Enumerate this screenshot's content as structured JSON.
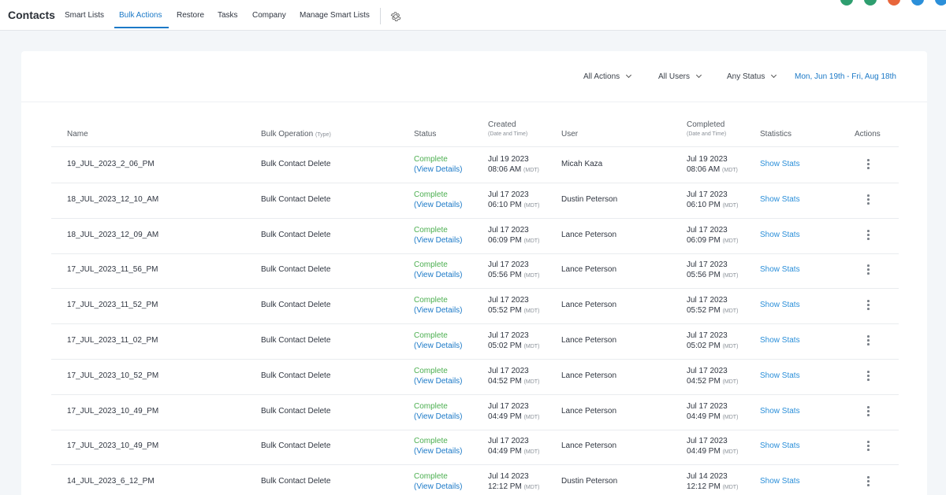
{
  "header": {
    "title": "Contacts",
    "tabs": [
      "Smart Lists",
      "Bulk Actions",
      "Restore",
      "Tasks",
      "Company",
      "Manage Smart Lists"
    ],
    "active_tab": "Bulk Actions",
    "avatar_colors": [
      "#2e9e6f",
      "#2e9e6f",
      "#e8663b",
      "#2b8fd9",
      "#2b8fd9"
    ]
  },
  "filters": {
    "actions": "All Actions",
    "users": "All Users",
    "status": "Any Status",
    "date_range": "Mon, Jun 19th - Fri, Aug 18th"
  },
  "table": {
    "columns": {
      "name": "Name",
      "operation": "Bulk Operation",
      "operation_sub": "(Type)",
      "status": "Status",
      "created": "Created",
      "created_sub": "(Date and Time)",
      "user": "User",
      "completed": "Completed",
      "completed_sub": "(Date and Time)",
      "statistics": "Statistics",
      "actions": "Actions"
    },
    "rows": [
      {
        "name": "19_JUL_2023_2_06_PM",
        "operation": "Bulk Contact Delete",
        "status": "Complete",
        "details": "(View Details)",
        "created_date": "Jul 19 2023",
        "created_time": "08:06 AM",
        "tz": "(MDT)",
        "user": "Micah Kaza",
        "completed_date": "Jul 19 2023",
        "completed_time": "08:06 AM",
        "stats": "Show Stats"
      },
      {
        "name": "18_JUL_2023_12_10_AM",
        "operation": "Bulk Contact Delete",
        "status": "Complete",
        "details": "(View Details)",
        "created_date": "Jul 17 2023",
        "created_time": "06:10 PM",
        "tz": "(MDT)",
        "user": "Dustin Peterson",
        "completed_date": "Jul 17 2023",
        "completed_time": "06:10 PM",
        "stats": "Show Stats"
      },
      {
        "name": "18_JUL_2023_12_09_AM",
        "operation": "Bulk Contact Delete",
        "status": "Complete",
        "details": "(View Details)",
        "created_date": "Jul 17 2023",
        "created_time": "06:09 PM",
        "tz": "(MDT)",
        "user": "Lance Peterson",
        "completed_date": "Jul 17 2023",
        "completed_time": "06:09 PM",
        "stats": "Show Stats"
      },
      {
        "name": "17_JUL_2023_11_56_PM",
        "operation": "Bulk Contact Delete",
        "status": "Complete",
        "details": "(View Details)",
        "created_date": "Jul 17 2023",
        "created_time": "05:56 PM",
        "tz": "(MDT)",
        "user": "Lance Peterson",
        "completed_date": "Jul 17 2023",
        "completed_time": "05:56 PM",
        "stats": "Show Stats"
      },
      {
        "name": "17_JUL_2023_11_52_PM",
        "operation": "Bulk Contact Delete",
        "status": "Complete",
        "details": "(View Details)",
        "created_date": "Jul 17 2023",
        "created_time": "05:52 PM",
        "tz": "(MDT)",
        "user": "Lance Peterson",
        "completed_date": "Jul 17 2023",
        "completed_time": "05:52 PM",
        "stats": "Show Stats"
      },
      {
        "name": "17_JUL_2023_11_02_PM",
        "operation": "Bulk Contact Delete",
        "status": "Complete",
        "details": "(View Details)",
        "created_date": "Jul 17 2023",
        "created_time": "05:02 PM",
        "tz": "(MDT)",
        "user": "Lance Peterson",
        "completed_date": "Jul 17 2023",
        "completed_time": "05:02 PM",
        "stats": "Show Stats"
      },
      {
        "name": "17_JUL_2023_10_52_PM",
        "operation": "Bulk Contact Delete",
        "status": "Complete",
        "details": "(View Details)",
        "created_date": "Jul 17 2023",
        "created_time": "04:52 PM",
        "tz": "(MDT)",
        "user": "Lance Peterson",
        "completed_date": "Jul 17 2023",
        "completed_time": "04:52 PM",
        "stats": "Show Stats"
      },
      {
        "name": "17_JUL_2023_10_49_PM",
        "operation": "Bulk Contact Delete",
        "status": "Complete",
        "details": "(View Details)",
        "created_date": "Jul 17 2023",
        "created_time": "04:49 PM",
        "tz": "(MDT)",
        "user": "Lance Peterson",
        "completed_date": "Jul 17 2023",
        "completed_time": "04:49 PM",
        "stats": "Show Stats"
      },
      {
        "name": "17_JUL_2023_10_49_PM",
        "operation": "Bulk Contact Delete",
        "status": "Complete",
        "details": "(View Details)",
        "created_date": "Jul 17 2023",
        "created_time": "04:49 PM",
        "tz": "(MDT)",
        "user": "Lance Peterson",
        "completed_date": "Jul 17 2023",
        "completed_time": "04:49 PM",
        "stats": "Show Stats"
      },
      {
        "name": "14_JUL_2023_6_12_PM",
        "operation": "Bulk Contact Delete",
        "status": "Complete",
        "details": "(View Details)",
        "created_date": "Jul 14 2023",
        "created_time": "12:12 PM",
        "tz": "(MDT)",
        "user": "Dustin Peterson",
        "completed_date": "Jul 14 2023",
        "completed_time": "12:12 PM",
        "stats": "Show Stats"
      }
    ]
  }
}
